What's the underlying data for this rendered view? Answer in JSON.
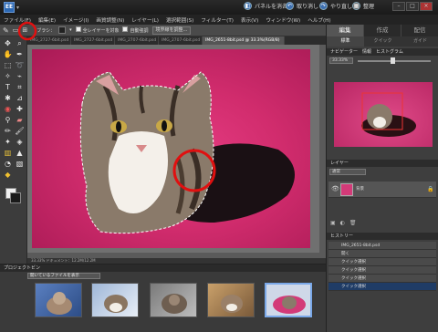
{
  "titlebar": {
    "logo": "EE",
    "partial_match": "パネルを消去",
    "undo": "取り消し",
    "redo": "やり直し",
    "organizer": "整理"
  },
  "menu": [
    "ファイル(F)",
    "編集(E)",
    "イメージ(I)",
    "画質調整(N)",
    "レイヤー(L)",
    "選択範囲(S)",
    "フィルター(T)",
    "表示(V)",
    "ウィンドウ(W)",
    "ヘルプ(H)"
  ],
  "options": {
    "brush_label": "ブラシ：",
    "sample_all": "全レイヤーを対象",
    "auto_enhance": "自動強調",
    "refine_edge": "境界線を調整..."
  },
  "tabs": [
    "IMG_2727-6bit.psd",
    "IMG_2727-6bit.psd",
    "IMG_2707-6bit.psd",
    "IMG_2707-6bit.psd",
    "IMG_2651-8bit.psd @ 33.3%(RGB/8)"
  ],
  "status": "33.33%    ドキュメント：12.2M/12.2M",
  "bin": {
    "header": "プロジェクトビン",
    "select": "開いているファイルを表示"
  },
  "right": {
    "modes": [
      "編集",
      "作成",
      "配信"
    ],
    "subtabs": [
      "標準",
      "クイック",
      "ガイド"
    ],
    "nav_head": "ナビゲーター　情報　ヒストグラム",
    "zoom": "33.33%",
    "layers_head": "レイヤー",
    "layer_mode": "通常",
    "layer_name": "背景",
    "history_head": "ヒストリー",
    "history": [
      "IMG_2651-8bit.psd",
      "開く",
      "クイック選択",
      "クイック選択",
      "クイック選択",
      "クイック選択"
    ]
  }
}
